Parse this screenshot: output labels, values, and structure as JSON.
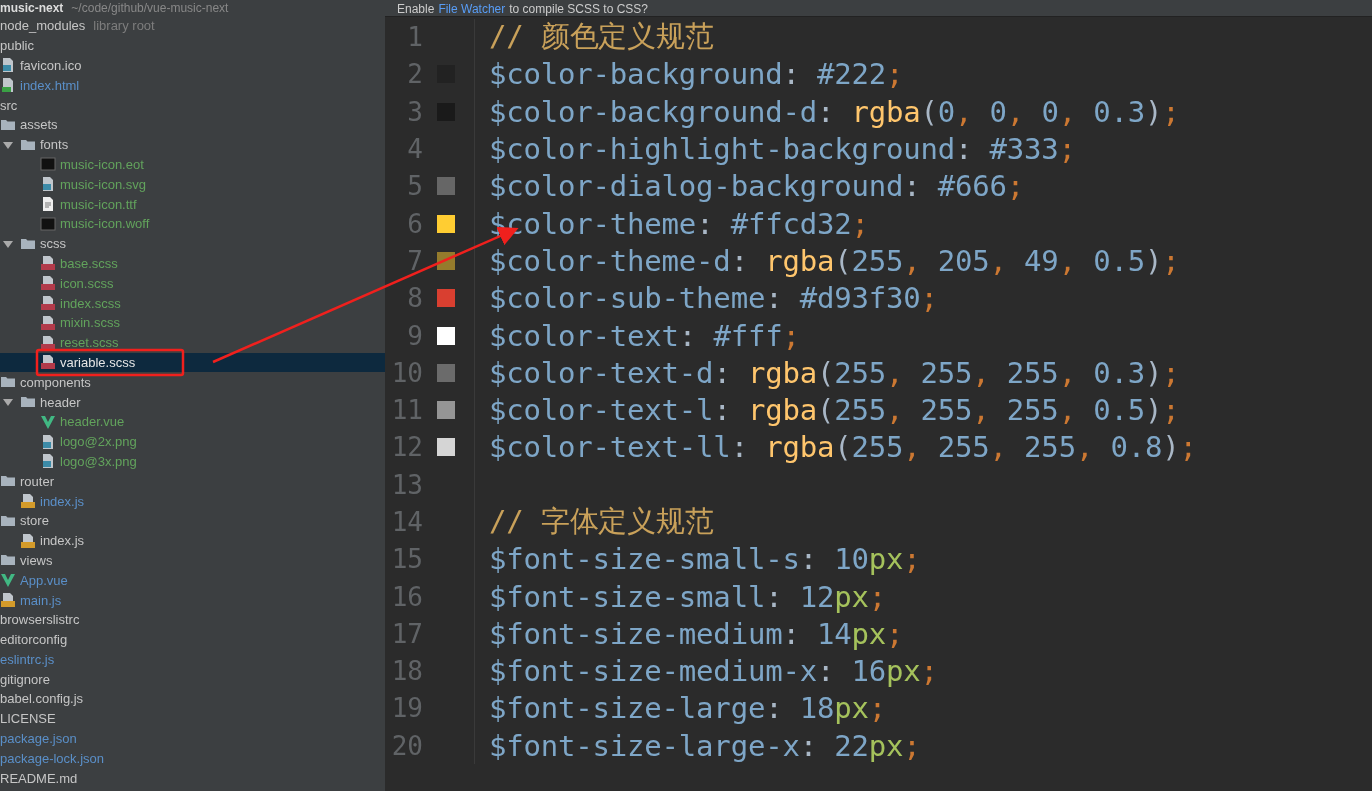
{
  "project": {
    "name": "music-next",
    "path": "~/code/github/vue-music-next"
  },
  "tree": [
    {
      "label": "node_modules",
      "color": "#c6c6c6",
      "selected": false,
      "note": "library root"
    },
    {
      "label": "public",
      "color": "#c6c6c6",
      "selected": false,
      "children": [
        {
          "label": "favicon.ico",
          "kind": "image",
          "color": "#c6c6c6",
          "selected": false
        },
        {
          "label": "index.html",
          "kind": "html",
          "color": "#5a8fc8",
          "selected": false
        }
      ]
    },
    {
      "label": "src",
      "color": "#c6c6c6",
      "selected": false,
      "children": [
        {
          "label": "assets",
          "kind": "folder",
          "color": "#c6c6c6",
          "selected": false,
          "children": [
            {
              "label": "fonts",
              "kind": "folder",
              "color": "#c6c6c6",
              "selected": false,
              "expanded": true,
              "children": [
                {
                  "label": "music-icon.eot",
                  "kind": "binary",
                  "color": "#62a35c",
                  "selected": false
                },
                {
                  "label": "music-icon.svg",
                  "kind": "image",
                  "color": "#62a35c",
                  "selected": false
                },
                {
                  "label": "music-icon.ttf",
                  "kind": "document",
                  "color": "#62a35c",
                  "selected": false
                },
                {
                  "label": "music-icon.woff",
                  "kind": "binary",
                  "color": "#62a35c",
                  "selected": false
                }
              ]
            },
            {
              "label": "scss",
              "kind": "folder",
              "color": "#c6c6c6",
              "selected": false,
              "expanded": true,
              "children": [
                {
                  "label": "base.scss",
                  "kind": "scss",
                  "color": "#62a35c",
                  "selected": false
                },
                {
                  "label": "icon.scss",
                  "kind": "scss",
                  "color": "#62a35c",
                  "selected": false
                },
                {
                  "label": "index.scss",
                  "kind": "scss",
                  "color": "#62a35c",
                  "selected": false
                },
                {
                  "label": "mixin.scss",
                  "kind": "scss",
                  "color": "#62a35c",
                  "selected": false
                },
                {
                  "label": "reset.scss",
                  "kind": "scss",
                  "color": "#62a35c",
                  "selected": false
                },
                {
                  "label": "variable.scss",
                  "kind": "scss",
                  "color": "#e6e6e6",
                  "selected": true
                }
              ]
            }
          ]
        },
        {
          "label": "components",
          "kind": "folder",
          "color": "#c6c6c6",
          "selected": false,
          "children": [
            {
              "label": "header",
              "kind": "folder",
              "color": "#c6c6c6",
              "selected": false,
              "expanded": true,
              "children": [
                {
                  "label": "header.vue",
                  "kind": "vue",
                  "color": "#62a35c",
                  "selected": false
                },
                {
                  "label": "logo@2x.png",
                  "kind": "image",
                  "color": "#62a35c",
                  "selected": false
                },
                {
                  "label": "logo@3x.png",
                  "kind": "image",
                  "color": "#62a35c",
                  "selected": false
                }
              ]
            }
          ]
        },
        {
          "label": "router",
          "kind": "folder",
          "color": "#c6c6c6",
          "selected": false,
          "children": [
            {
              "label": "index.js",
              "kind": "js",
              "color": "#5a8fc8",
              "selected": false
            }
          ]
        },
        {
          "label": "store",
          "kind": "folder",
          "color": "#c6c6c6",
          "selected": false,
          "children": [
            {
              "label": "index.js",
              "kind": "js",
              "color": "#c6c6c6",
              "selected": false
            }
          ]
        },
        {
          "label": "views",
          "kind": "folder",
          "color": "#c6c6c6",
          "selected": false
        },
        {
          "label": "App.vue",
          "kind": "vue",
          "color": "#5a8fc8",
          "selected": false
        },
        {
          "label": "main.js",
          "kind": "js",
          "color": "#5a8fc8",
          "selected": false
        }
      ]
    },
    {
      "label": "browserslistrc",
      "color": "#c6c6c6",
      "selected": false
    },
    {
      "label": "editorconfig",
      "color": "#c6c6c6",
      "selected": false
    },
    {
      "label": "eslintrc.js",
      "color": "#5a8fc8",
      "selected": false
    },
    {
      "label": "gitignore",
      "color": "#c6c6c6",
      "selected": false
    },
    {
      "label": "babel.config.js",
      "color": "#c6c6c6",
      "selected": false
    },
    {
      "label": "LICENSE",
      "color": "#c6c6c6",
      "selected": false
    },
    {
      "label": "package.json",
      "color": "#5a8fc8",
      "selected": false
    },
    {
      "label": "package-lock.json",
      "color": "#5a8fc8",
      "selected": false
    },
    {
      "label": "README.md",
      "color": "#c6c6c6",
      "selected": false
    }
  ],
  "banner": {
    "before": "Enable",
    "link": "File Watcher",
    "after": "to compile SCSS to CSS?"
  },
  "editor": {
    "lines": [
      {
        "number": "1",
        "tokens": [
          {
            "color": "#c9a15a",
            "text": "// 颜色定义规范"
          }
        ]
      },
      {
        "number": "2",
        "color": "#222222",
        "tokens": [
          {
            "color": "#7ea6c7",
            "text": "$color-background"
          },
          {
            "color": "#a9b7c6",
            "text": ": "
          },
          {
            "color": "#7ea6c7",
            "text": "#222"
          },
          {
            "color": "#cc7832",
            "text": ";"
          }
        ]
      },
      {
        "number": "3",
        "color": "#1a1a1a",
        "tokens": [
          {
            "color": "#7ea6c7",
            "text": "$color-background-d"
          },
          {
            "color": "#a9b7c6",
            "text": ": "
          },
          {
            "color": "#ffc66d",
            "text": "rgba"
          },
          {
            "color": "#a9b7c6",
            "text": "("
          },
          {
            "color": "#7ea6c7",
            "text": "0"
          },
          {
            "color": "#cc7832",
            "text": ", "
          },
          {
            "color": "#7ea6c7",
            "text": "0"
          },
          {
            "color": "#cc7832",
            "text": ", "
          },
          {
            "color": "#7ea6c7",
            "text": "0"
          },
          {
            "color": "#cc7832",
            "text": ", "
          },
          {
            "color": "#7ea6c7",
            "text": "0.3"
          },
          {
            "color": "#a9b7c6",
            "text": ")"
          },
          {
            "color": "#cc7832",
            "text": ";"
          }
        ]
      },
      {
        "number": "4",
        "tokens": [
          {
            "color": "#7ea6c7",
            "text": "$color-highlight-background"
          },
          {
            "color": "#a9b7c6",
            "text": ": "
          },
          {
            "color": "#7ea6c7",
            "text": "#333"
          },
          {
            "color": "#cc7832",
            "text": ";"
          }
        ]
      },
      {
        "number": "5",
        "color": "#666666",
        "tokens": [
          {
            "color": "#7ea6c7",
            "text": "$color-dialog-background"
          },
          {
            "color": "#a9b7c6",
            "text": ": "
          },
          {
            "color": "#7ea6c7",
            "text": "#666"
          },
          {
            "color": "#cc7832",
            "text": ";"
          }
        ]
      },
      {
        "number": "6",
        "color": "#ffcd32",
        "tokens": [
          {
            "color": "#7ea6c7",
            "text": "$color-theme"
          },
          {
            "color": "#a9b7c6",
            "text": ": "
          },
          {
            "color": "#7ea6c7",
            "text": "#ffcd32"
          },
          {
            "color": "#cc7832",
            "text": ";"
          }
        ]
      },
      {
        "number": "7",
        "color": "#957b2c",
        "tokens": [
          {
            "color": "#7ea6c7",
            "text": "$color-theme-d"
          },
          {
            "color": "#a9b7c6",
            "text": ": "
          },
          {
            "color": "#ffc66d",
            "text": "rgba"
          },
          {
            "color": "#a9b7c6",
            "text": "("
          },
          {
            "color": "#7ea6c7",
            "text": "255"
          },
          {
            "color": "#cc7832",
            "text": ", "
          },
          {
            "color": "#7ea6c7",
            "text": "205"
          },
          {
            "color": "#cc7832",
            "text": ", "
          },
          {
            "color": "#7ea6c7",
            "text": "49"
          },
          {
            "color": "#cc7832",
            "text": ", "
          },
          {
            "color": "#7ea6c7",
            "text": "0.5"
          },
          {
            "color": "#a9b7c6",
            "text": ")"
          },
          {
            "color": "#cc7832",
            "text": ";"
          }
        ]
      },
      {
        "number": "8",
        "color": "#d93f30",
        "tokens": [
          {
            "color": "#7ea6c7",
            "text": "$color-sub-theme"
          },
          {
            "color": "#a9b7c6",
            "text": ": "
          },
          {
            "color": "#7ea6c7",
            "text": "#d93f30"
          },
          {
            "color": "#cc7832",
            "text": ";"
          }
        ]
      },
      {
        "number": "9",
        "color": "#ffffff",
        "tokens": [
          {
            "color": "#7ea6c7",
            "text": "$color-text"
          },
          {
            "color": "#a9b7c6",
            "text": ": "
          },
          {
            "color": "#7ea6c7",
            "text": "#fff"
          },
          {
            "color": "#cc7832",
            "text": ";"
          }
        ]
      },
      {
        "number": "10",
        "color": "#6b6b6b",
        "tokens": [
          {
            "color": "#7ea6c7",
            "text": "$color-text-d"
          },
          {
            "color": "#a9b7c6",
            "text": ": "
          },
          {
            "color": "#ffc66d",
            "text": "rgba"
          },
          {
            "color": "#a9b7c6",
            "text": "("
          },
          {
            "color": "#7ea6c7",
            "text": "255"
          },
          {
            "color": "#cc7832",
            "text": ", "
          },
          {
            "color": "#7ea6c7",
            "text": "255"
          },
          {
            "color": "#cc7832",
            "text": ", "
          },
          {
            "color": "#7ea6c7",
            "text": "255"
          },
          {
            "color": "#cc7832",
            "text": ", "
          },
          {
            "color": "#7ea6c7",
            "text": "0.3"
          },
          {
            "color": "#a9b7c6",
            "text": ")"
          },
          {
            "color": "#cc7832",
            "text": ";"
          }
        ]
      },
      {
        "number": "11",
        "color": "#959595",
        "tokens": [
          {
            "color": "#7ea6c7",
            "text": "$color-text-l"
          },
          {
            "color": "#a9b7c6",
            "text": ": "
          },
          {
            "color": "#ffc66d",
            "text": "rgba"
          },
          {
            "color": "#a9b7c6",
            "text": "("
          },
          {
            "color": "#7ea6c7",
            "text": "255"
          },
          {
            "color": "#cc7832",
            "text": ", "
          },
          {
            "color": "#7ea6c7",
            "text": "255"
          },
          {
            "color": "#cc7832",
            "text": ", "
          },
          {
            "color": "#7ea6c7",
            "text": "255"
          },
          {
            "color": "#cc7832",
            "text": ", "
          },
          {
            "color": "#7ea6c7",
            "text": "0.5"
          },
          {
            "color": "#a9b7c6",
            "text": ")"
          },
          {
            "color": "#cc7832",
            "text": ";"
          }
        ]
      },
      {
        "number": "12",
        "color": "#d5d5d5",
        "tokens": [
          {
            "color": "#7ea6c7",
            "text": "$color-text-ll"
          },
          {
            "color": "#a9b7c6",
            "text": ": "
          },
          {
            "color": "#ffc66d",
            "text": "rgba"
          },
          {
            "color": "#a9b7c6",
            "text": "("
          },
          {
            "color": "#7ea6c7",
            "text": "255"
          },
          {
            "color": "#cc7832",
            "text": ", "
          },
          {
            "color": "#7ea6c7",
            "text": "255"
          },
          {
            "color": "#cc7832",
            "text": ", "
          },
          {
            "color": "#7ea6c7",
            "text": "255"
          },
          {
            "color": "#cc7832",
            "text": ", "
          },
          {
            "color": "#7ea6c7",
            "text": "0.8"
          },
          {
            "color": "#a9b7c6",
            "text": ")"
          },
          {
            "color": "#cc7832",
            "text": ";"
          }
        ]
      },
      {
        "number": "13"
      },
      {
        "number": "14",
        "tokens": [
          {
            "color": "#c9a15a",
            "text": "// 字体定义规范"
          }
        ]
      },
      {
        "number": "15",
        "tokens": [
          {
            "color": "#7ea6c7",
            "text": "$font-size-small-s"
          },
          {
            "color": "#a9b7c6",
            "text": ": "
          },
          {
            "color": "#7ea6c7",
            "text": "10"
          },
          {
            "color": "#a5c25c",
            "text": "px"
          },
          {
            "color": "#cc7832",
            "text": ";"
          }
        ]
      },
      {
        "number": "16",
        "tokens": [
          {
            "color": "#7ea6c7",
            "text": "$font-size-small"
          },
          {
            "color": "#a9b7c6",
            "text": ": "
          },
          {
            "color": "#7ea6c7",
            "text": "12"
          },
          {
            "color": "#a5c25c",
            "text": "px"
          },
          {
            "color": "#cc7832",
            "text": ";"
          }
        ]
      },
      {
        "number": "17",
        "tokens": [
          {
            "color": "#7ea6c7",
            "text": "$font-size-medium"
          },
          {
            "color": "#a9b7c6",
            "text": ": "
          },
          {
            "color": "#7ea6c7",
            "text": "14"
          },
          {
            "color": "#a5c25c",
            "text": "px"
          },
          {
            "color": "#cc7832",
            "text": ";"
          }
        ]
      },
      {
        "number": "18",
        "tokens": [
          {
            "color": "#7ea6c7",
            "text": "$font-size-medium-x"
          },
          {
            "color": "#a9b7c6",
            "text": ": "
          },
          {
            "color": "#7ea6c7",
            "text": "16"
          },
          {
            "color": "#a5c25c",
            "text": "px"
          },
          {
            "color": "#cc7832",
            "text": ";"
          }
        ]
      },
      {
        "number": "19",
        "tokens": [
          {
            "color": "#7ea6c7",
            "text": "$font-size-large"
          },
          {
            "color": "#a9b7c6",
            "text": ": "
          },
          {
            "color": "#7ea6c7",
            "text": "18"
          },
          {
            "color": "#a5c25c",
            "text": "px"
          },
          {
            "color": "#cc7832",
            "text": ";"
          }
        ]
      },
      {
        "number": "20",
        "tokens": [
          {
            "color": "#7ea6c7",
            "text": "$font-size-large-x"
          },
          {
            "color": "#a9b7c6",
            "text": ": "
          },
          {
            "color": "#7ea6c7",
            "text": "22"
          },
          {
            "color": "#a5c25c",
            "text": "px"
          },
          {
            "color": "#cc7832",
            "text": ";"
          }
        ]
      }
    ]
  },
  "annotation": {
    "box": true,
    "arrow": true
  }
}
